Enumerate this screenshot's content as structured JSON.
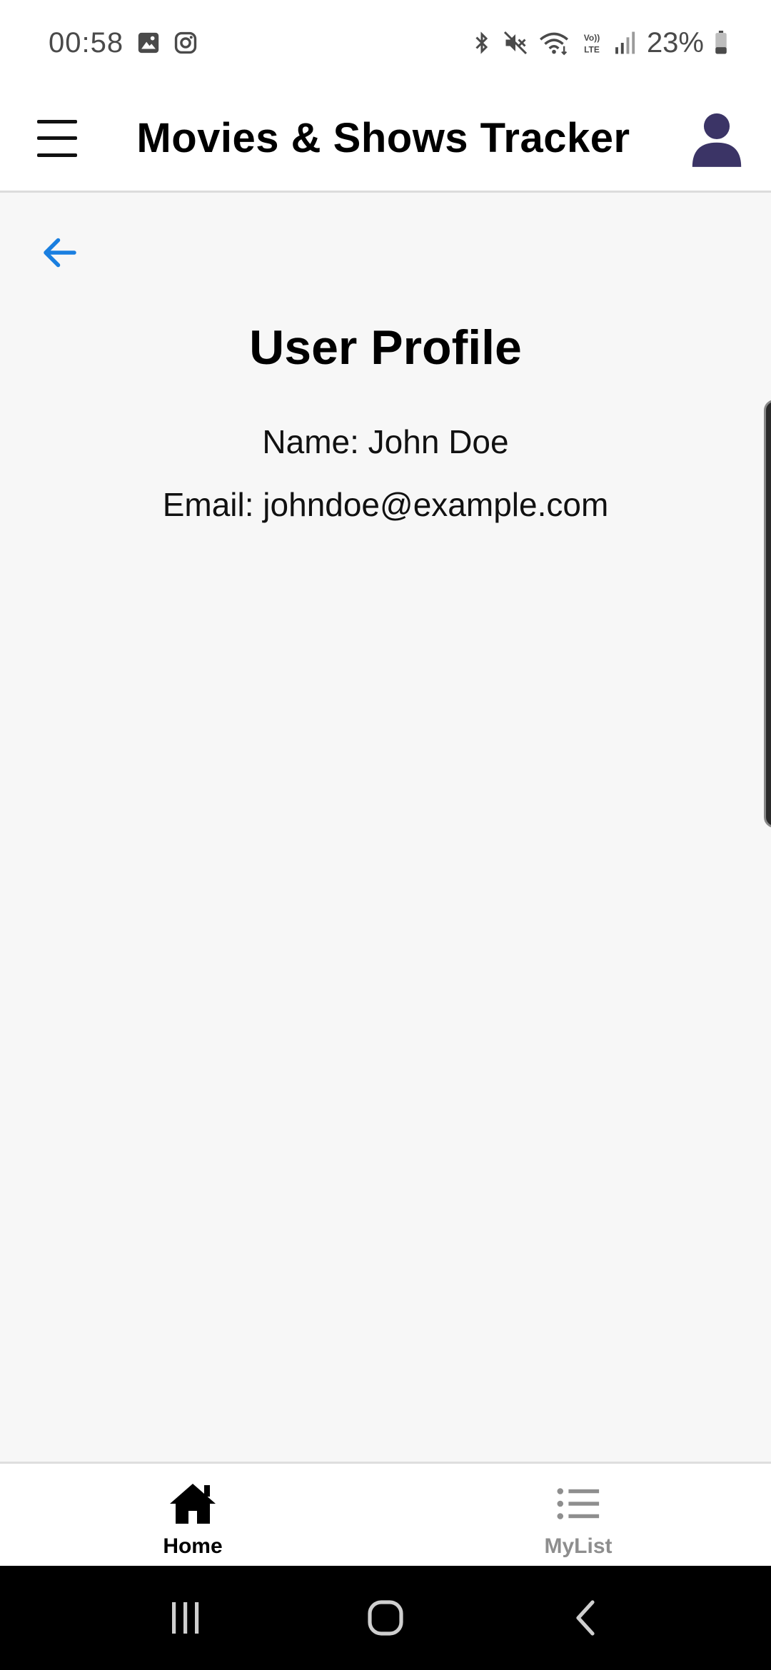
{
  "status_bar": {
    "time": "00:58",
    "battery": "23%",
    "icons": [
      "gallery-icon",
      "instagram-icon",
      "bluetooth-icon",
      "mute-icon",
      "wifi-icon",
      "volte-icon",
      "signal-icon",
      "battery-icon"
    ]
  },
  "header": {
    "title": "Movies & Shows Tracker",
    "menu_icon": "hamburger-menu-icon",
    "avatar_icon": "user-silhouette-icon"
  },
  "page": {
    "title": "User Profile",
    "name_line": "Name: John Doe",
    "email_line": "Email: johndoe@example.com"
  },
  "bottom_nav": {
    "items": [
      {
        "label": "Home",
        "icon": "home-icon",
        "active": true
      },
      {
        "label": "MyList",
        "icon": "list-icon",
        "active": false
      }
    ]
  },
  "colors": {
    "accent": "#1a7fe0",
    "background": "#f7f7f7",
    "header_bg": "#ffffff",
    "avatar": "#3b3466"
  }
}
